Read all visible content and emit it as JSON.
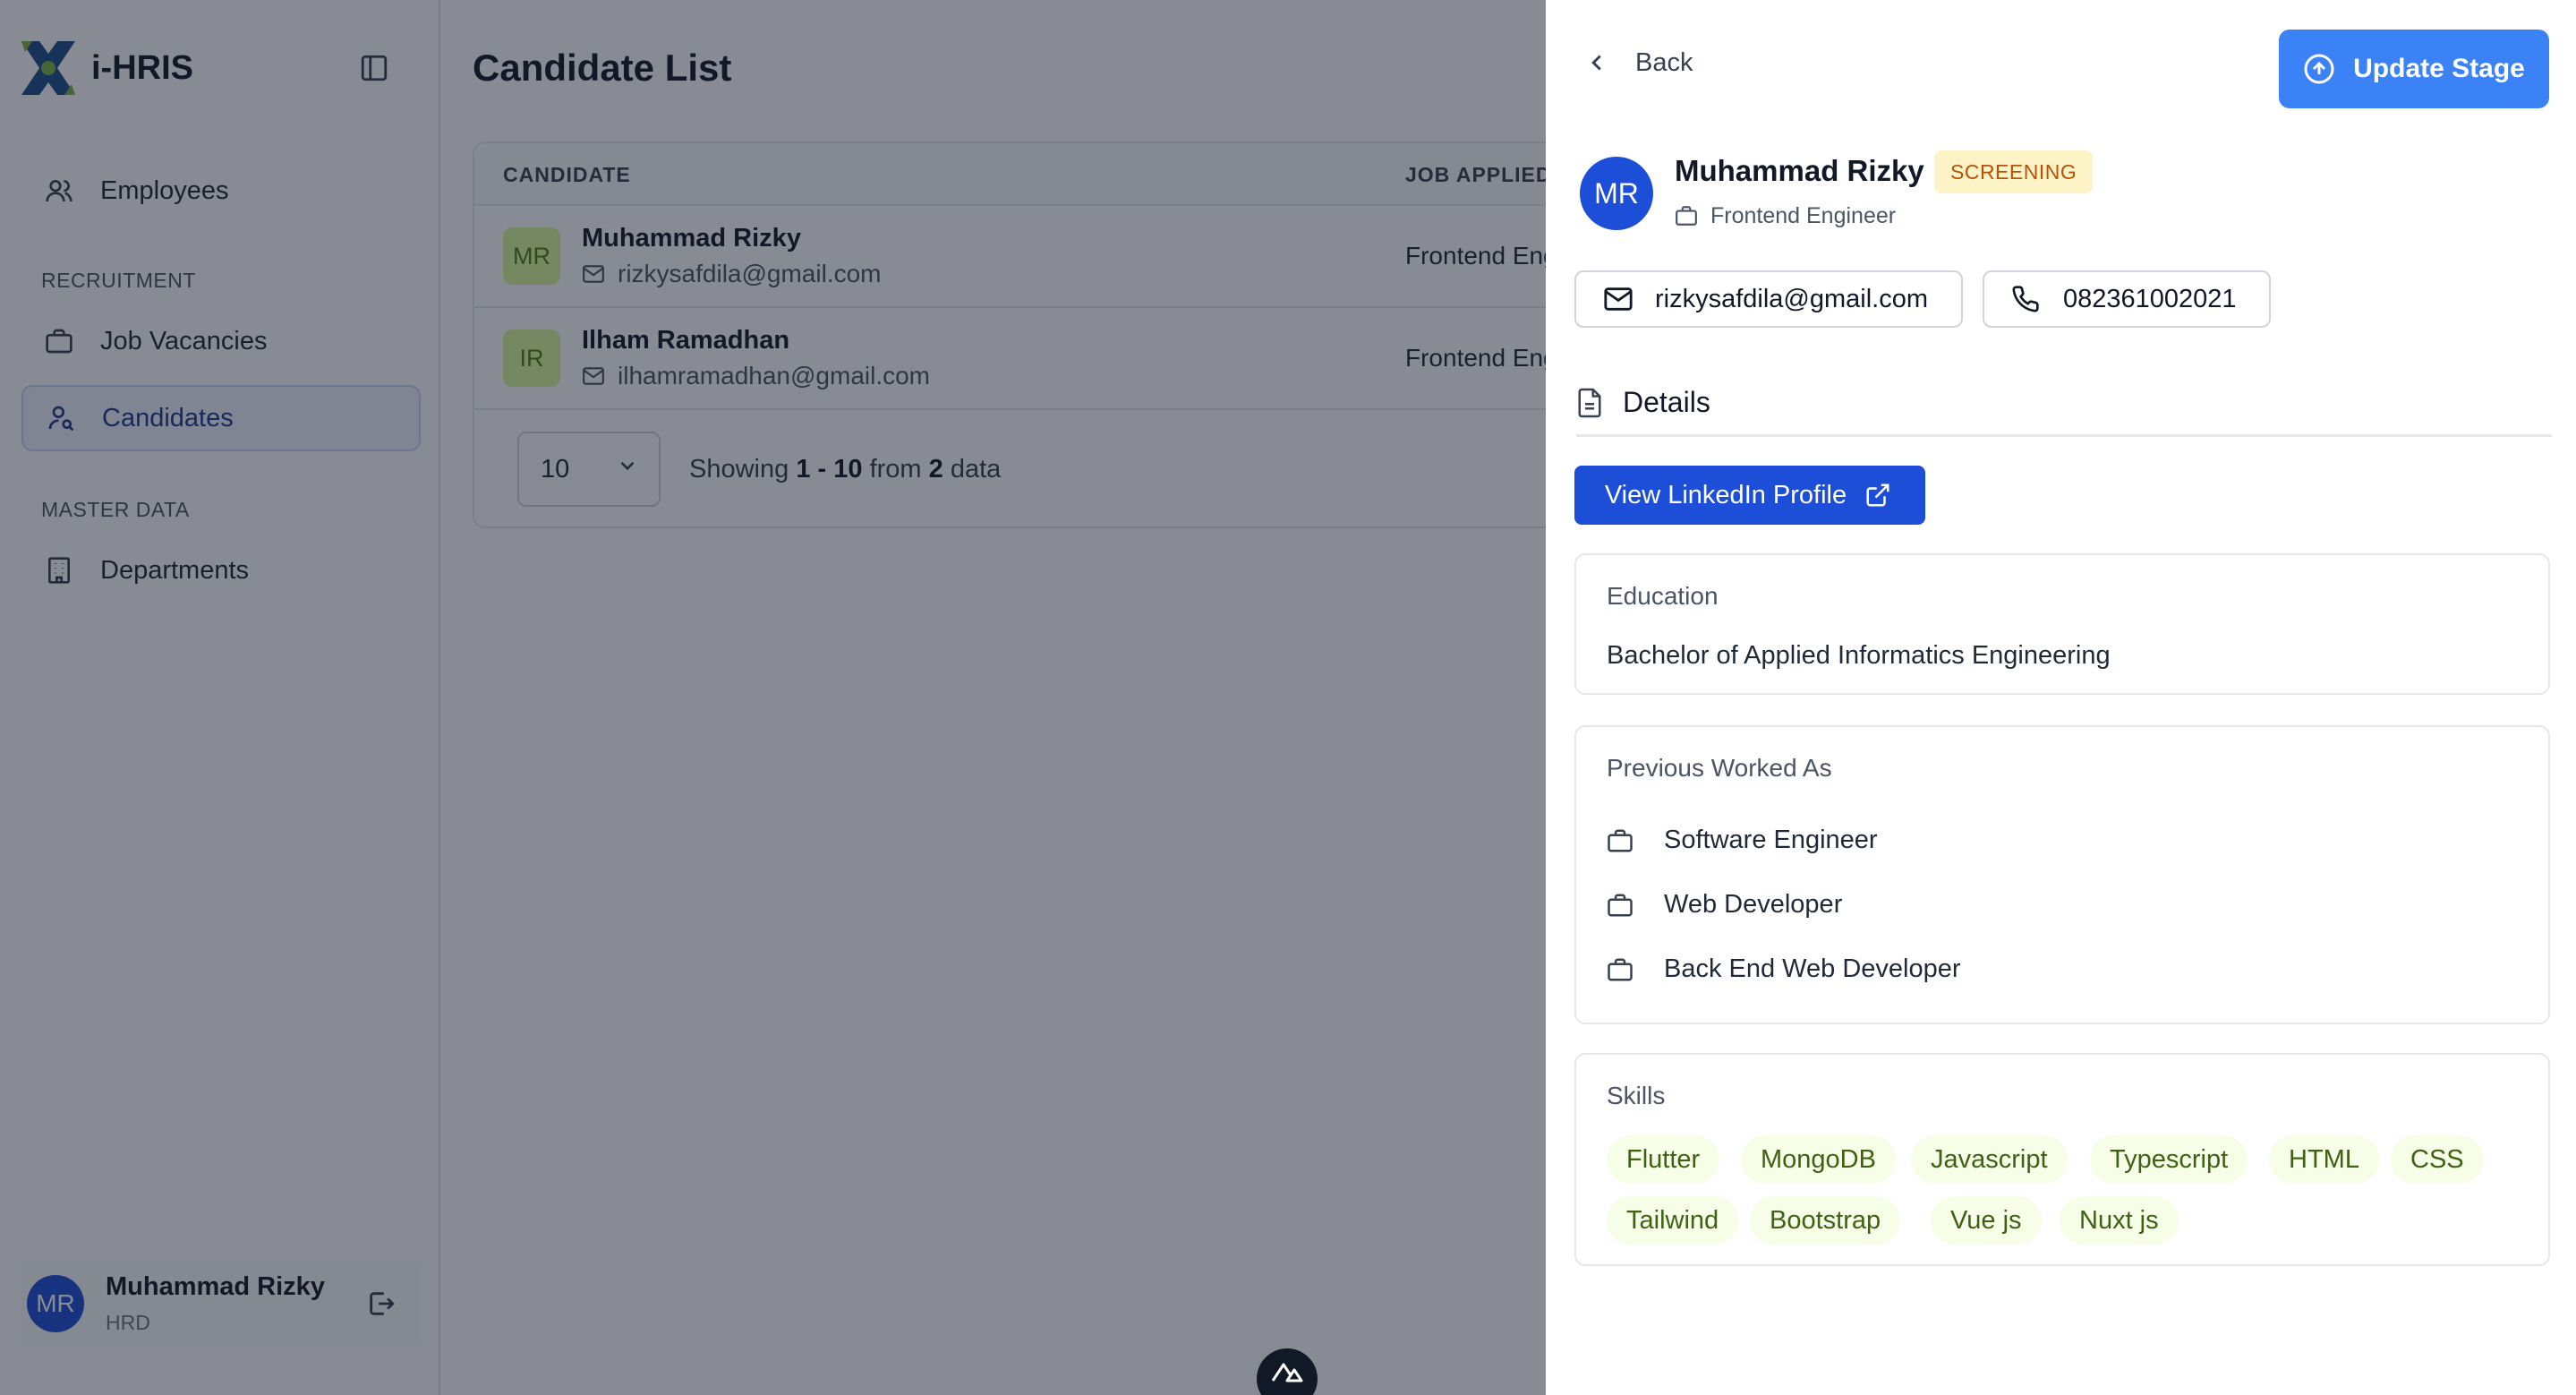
{
  "app": {
    "name": "i-HRIS"
  },
  "sidebar": {
    "items": [
      {
        "label": "Employees"
      },
      {
        "label": "Job Vacancies"
      },
      {
        "label": "Candidates"
      },
      {
        "label": "Departments"
      }
    ],
    "sections": {
      "recruitment": "RECRUITMENT",
      "master_data": "MASTER DATA"
    },
    "user": {
      "initials": "MR",
      "name": "Muhammad Rizky",
      "role": "HRD"
    }
  },
  "main": {
    "title": "Candidate List",
    "columns": [
      "CANDIDATE",
      "JOB APPLIED"
    ],
    "rows": [
      {
        "initials": "MR",
        "name": "Muhammad Rizky",
        "email": "rizkysafdila@gmail.com",
        "job": "Frontend Engineer"
      },
      {
        "initials": "IR",
        "name": "Ilham Ramadhan",
        "email": "ilhamramadhan@gmail.com",
        "job": "Frontend Engineer"
      }
    ],
    "pagination": {
      "per_page": "10",
      "showing_label": "Showing",
      "range_start": "1",
      "range_sep": "-",
      "range_end": "10",
      "from_label": "from",
      "total": "2",
      "data_label": "data"
    }
  },
  "drawer": {
    "back_label": "Back",
    "update_label": "Update Stage",
    "candidate": {
      "initials": "MR",
      "name": "Muhammad Rizky",
      "stage": "SCREENING",
      "role": "Frontend Engineer",
      "email": "rizkysafdila@gmail.com",
      "phone": "082361002021"
    },
    "details_title": "Details",
    "linkedin_label": "View LinkedIn Profile",
    "education": {
      "label": "Education",
      "value": "Bachelor of Applied Informatics Engineering"
    },
    "previous": {
      "label": "Previous Worked As",
      "items": [
        "Software Engineer",
        "Web Developer",
        "Back End Web Developer"
      ]
    },
    "skills": {
      "label": "Skills",
      "items": [
        "Flutter",
        "MongoDB",
        "Javascript",
        "Typescript",
        "HTML",
        "CSS",
        "Tailwind",
        "Bootstrap",
        "Vue js",
        "Nuxt js"
      ]
    }
  },
  "colors": {
    "primary": "#3b82f6",
    "primary_dark": "#1d4ed8",
    "stage_bg": "#fef3c7",
    "stage_text": "#b45309",
    "skill_bg": "#f7fee7",
    "skill_text": "#3f6212",
    "overlay": "#111827"
  },
  "icons": [
    "logo-icon",
    "sidebar-toggle-icon",
    "users-icon",
    "briefcase-icon",
    "user-search-icon",
    "building-icon",
    "logout-icon",
    "mail-icon",
    "chevron-down-icon",
    "chevron-left-icon",
    "arrow-up-circle-icon",
    "phone-icon",
    "document-icon",
    "external-link-icon",
    "nuxt-icon"
  ]
}
